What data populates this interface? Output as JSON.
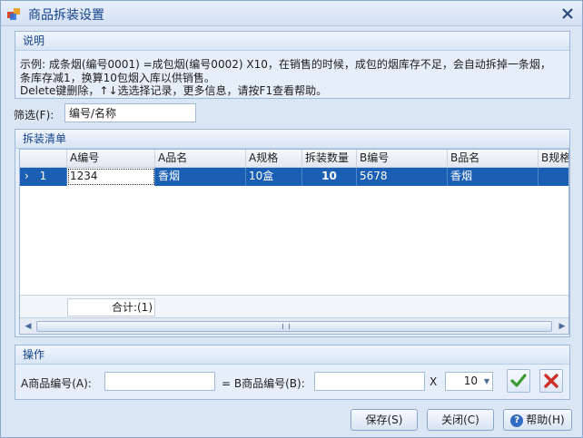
{
  "window": {
    "title": "商品拆装设置"
  },
  "description": {
    "header": "说明",
    "line1": "示例: 成条烟(编号0001) =成包烟(编号0002) X10，在销售的时候，成包的烟库存不足，会自动拆掉一条烟，",
    "line2": "条库存减1，换算10包烟入库以供销售。",
    "line3": "Delete键删除，↑↓选选择记录，更多信息，请按F1查看帮助。"
  },
  "filter": {
    "label": "筛选(F):",
    "value": "编号/名称"
  },
  "grid": {
    "header": "拆装清单",
    "columns": [
      "A编号",
      "A品名",
      "A规格",
      "拆装数量",
      "B编号",
      "B品名",
      "B规格"
    ],
    "rows": [
      {
        "indicator": "›",
        "index": "1",
        "a_code": "1234",
        "a_name": "香烟",
        "a_spec": "10盒",
        "qty": "10",
        "b_code": "5678",
        "b_name": "香烟",
        "b_spec": ""
      }
    ],
    "footer_total": "合计:(1)"
  },
  "operation": {
    "header": "操作",
    "a_label": "A商品编号(A):",
    "a_value": "",
    "eq_label": "= B商品编号(B):",
    "b_value": "",
    "x_label": "X",
    "multiplier": "10"
  },
  "buttons": {
    "save": "保存(S)",
    "close": "关闭(C)",
    "help": "帮助(H)",
    "help_icon_glyph": "?"
  },
  "colors": {
    "title": "#15428b",
    "selected_row": "#1a5fb4",
    "confirm": "#3b9a2f",
    "cancel": "#d0302a"
  }
}
